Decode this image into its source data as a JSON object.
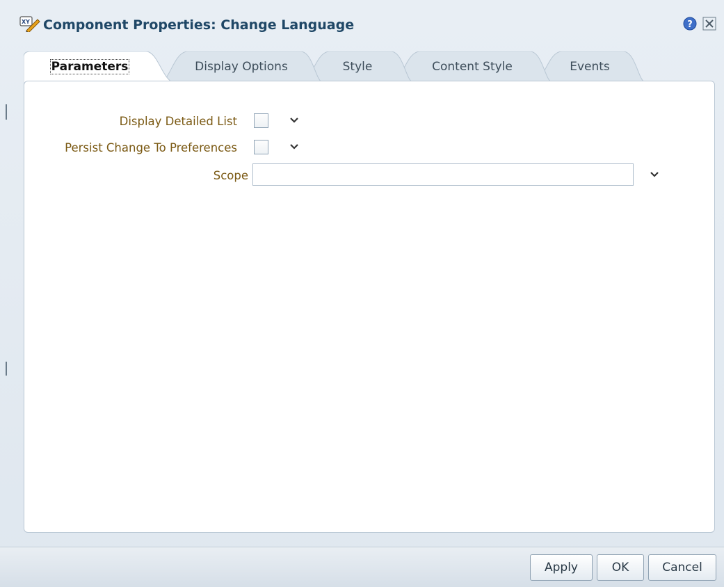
{
  "window": {
    "title": "Component Properties: Change Language",
    "icon": "edit-properties-icon",
    "help_icon": "help-icon",
    "close_icon": "close-icon"
  },
  "tabs": [
    {
      "label": "Parameters",
      "active": true
    },
    {
      "label": "Display Options",
      "active": false
    },
    {
      "label": "Style",
      "active": false
    },
    {
      "label": "Content Style",
      "active": false
    },
    {
      "label": "Events",
      "active": false
    }
  ],
  "parameters": {
    "display_detailed_list": {
      "label": "Display Detailed List",
      "checked": false
    },
    "persist_change": {
      "label": "Persist Change To Preferences",
      "checked": false
    },
    "scope": {
      "label": "Scope",
      "value": "",
      "placeholder": ""
    }
  },
  "footer": {
    "apply": "Apply",
    "ok": "OK",
    "cancel": "Cancel"
  },
  "colors": {
    "label_text": "#7b5a14",
    "title_text": "#1f4766"
  }
}
